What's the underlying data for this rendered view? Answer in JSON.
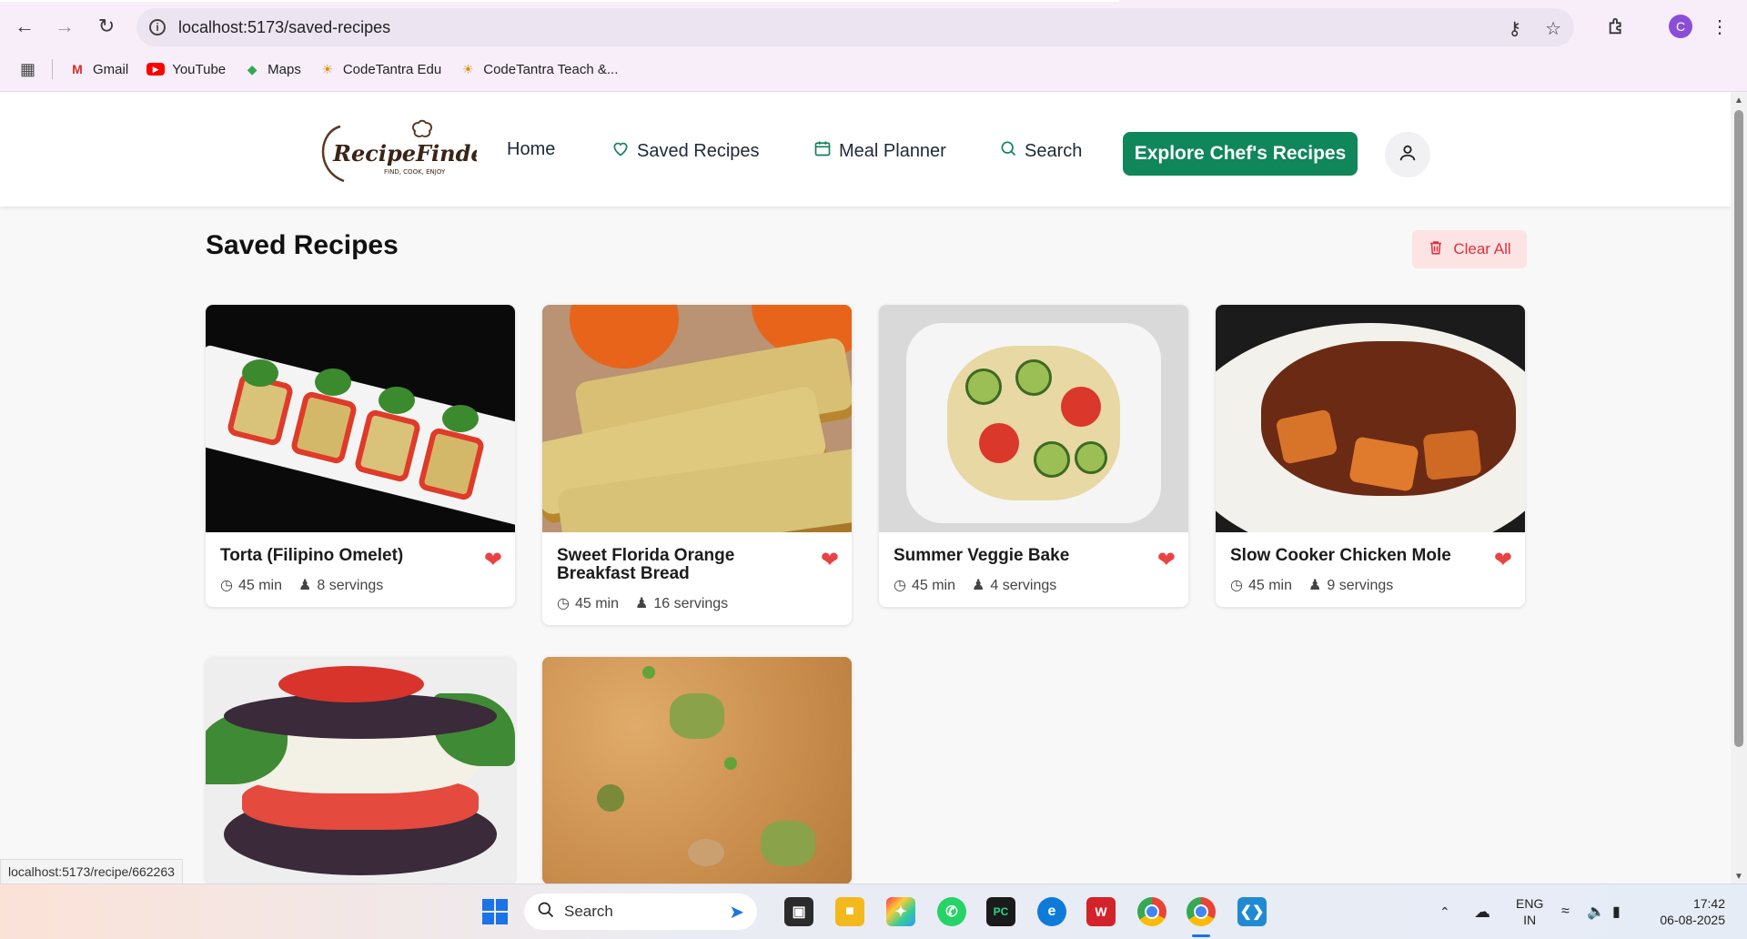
{
  "browser": {
    "url": "localhost:5173/saved-recipes",
    "bookmarks": [
      "Gmail",
      "YouTube",
      "Maps",
      "CodeTantra Edu",
      "CodeTantra Teach &..."
    ],
    "profile_initial": "C",
    "status_url": "localhost:5173/recipe/662263"
  },
  "site": {
    "logo_text": "RecipeFinder",
    "logo_tagline": "FIND, COOK, ENJOY",
    "nav": {
      "home": "Home",
      "saved": "Saved Recipes",
      "planner": "Meal Planner",
      "search": "Search"
    },
    "cta_label": "Explore Chef's Recipes"
  },
  "page": {
    "title": "Saved Recipes",
    "clear_label": "Clear All"
  },
  "recipes": [
    {
      "title": "Torta (Filipino Omelet)",
      "time": "45 min",
      "servings": "8 servings"
    },
    {
      "title": "Sweet Florida Orange Breakfast Bread",
      "time": "45 min",
      "servings": "16 servings"
    },
    {
      "title": "Summer Veggie Bake",
      "time": "45 min",
      "servings": "4 servings"
    },
    {
      "title": "Slow Cooker Chicken Mole",
      "time": "45 min",
      "servings": "9 servings"
    },
    {
      "title": "",
      "time": "",
      "servings": ""
    },
    {
      "title": "",
      "time": "",
      "servings": ""
    }
  ],
  "taskbar": {
    "search_label": "Search",
    "lang_top": "ENG",
    "lang_bottom": "IN",
    "time": "17:42",
    "date": "06-08-2025"
  },
  "colors": {
    "accent": "#10865b",
    "heart": "#e94343",
    "clear_bg": "#fde3e4",
    "clear_text": "#e0303b"
  }
}
